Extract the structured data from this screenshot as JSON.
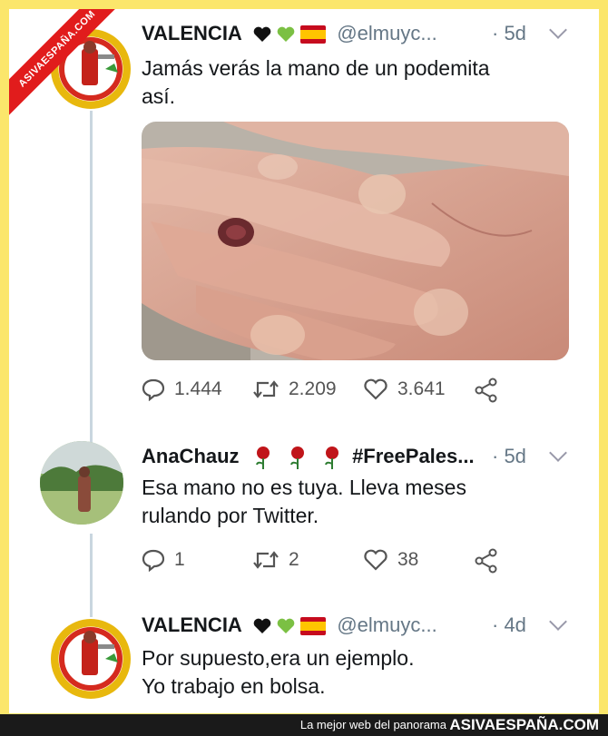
{
  "watermark": {
    "ribbon": "ASIVAESPAÑA.COM"
  },
  "tweets": [
    {
      "name": "VALENCIA",
      "handle": "@elmuyc...",
      "time": "· 5d",
      "text_lines": [
        "Jamás verás la mano de un podemita",
        "así."
      ],
      "replies": "1.444",
      "retweets": "2.209",
      "likes": "3.641"
    },
    {
      "name": "AnaChauz",
      "hashtag": "#FreePales...",
      "time": "· 5d",
      "text_lines": [
        "Esa mano no es tuya. Lleva meses",
        "rulando por Twitter."
      ],
      "replies": "1",
      "retweets": "2",
      "likes": "38"
    },
    {
      "name": "VALENCIA",
      "handle": "@elmuyc...",
      "time": "· 4d",
      "text_lines": [
        "Por supuesto,era un ejemplo.",
        "Yo trabajo en bolsa."
      ]
    }
  ],
  "footer": {
    "tagline": "La mejor web del panorama",
    "brand": "ASIVAESPAÑA.COM"
  },
  "colors": {
    "background": "#fbe66b",
    "ribbon": "#e11c1c",
    "heart_black": "#111111",
    "heart_green": "#7bc043",
    "rose": "#c0151a"
  },
  "icons": [
    "reply-icon",
    "retweet-icon",
    "like-icon",
    "share-icon",
    "chevron-down-icon"
  ]
}
